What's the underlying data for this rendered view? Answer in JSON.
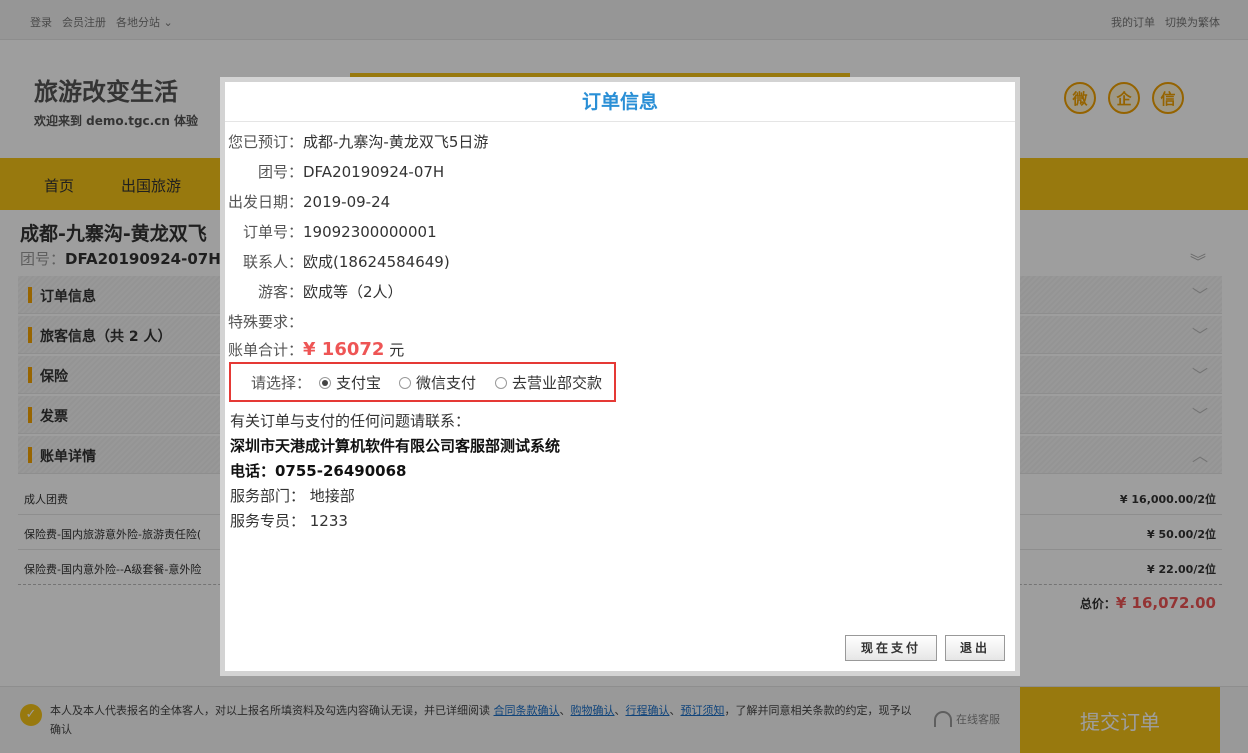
{
  "topbar": {
    "login": "登录",
    "register": "会员注册",
    "branches": "各地分站",
    "my_orders": "我的订单",
    "switch_traditional": "切换为繁体"
  },
  "header": {
    "brand_title": "旅游改变生活",
    "brand_subtitle": "欢迎来到 demo.tgc.cn 体验",
    "social": [
      "微",
      "企",
      "信"
    ]
  },
  "nav": {
    "items": [
      "首页",
      "出国旅游"
    ]
  },
  "product": {
    "title": "成都-九寨沟-黄龙双飞",
    "group_label": "团号：",
    "group_no": "DFA20190924-07H"
  },
  "sections": [
    {
      "label": "订单信息"
    },
    {
      "label": "旅客信息（共 2 人）"
    },
    {
      "label": "保险"
    },
    {
      "label": "发票"
    },
    {
      "label": "账单详情"
    }
  ],
  "fees": [
    {
      "name": "成人团费",
      "amount": "¥ 16,000.00/2位"
    },
    {
      "name": "保险费-国内旅游意外险-旅游责任险(",
      "amount": "¥ 50.00/2位"
    },
    {
      "name": "保险费-国内意外险--A级套餐-意外险",
      "amount": "¥ 22.00/2位"
    }
  ],
  "total": {
    "label": "总价：",
    "value": "¥ 16,072.00"
  },
  "footer": {
    "agree_prefix": "本人及本人代表报名的全体客人，对以上报名所填资料及勾选内容确认无误，并已详细阅读",
    "link_contract": "合同条款确认",
    "link_shopping": "购物确认",
    "link_itinerary": "行程确认",
    "link_notice": "预订须知",
    "agree_suffix": "，了解并同意相关条款的约定，现予以确认",
    "sep": "、",
    "online_service": "在线客服",
    "submit": "提交订单"
  },
  "modal": {
    "title": "订单信息",
    "rows": [
      {
        "label": "您已预订：",
        "value": "成都-九寨沟-黄龙双飞5日游"
      },
      {
        "label": "团号：",
        "value": "DFA20190924-07H"
      },
      {
        "label": "出发日期：",
        "value": "2019-09-24"
      },
      {
        "label": "订单号：",
        "value": "19092300000001"
      },
      {
        "label": "联系人：",
        "value": "欧成(18624584649)"
      },
      {
        "label": "游客：",
        "value": "欧成等（2人）"
      },
      {
        "label": "特殊要求：",
        "value": ""
      }
    ],
    "bill": {
      "label": "账单合计：",
      "amount": "¥ 16072",
      "unit": "元"
    },
    "payment": {
      "label": "请选择：",
      "options": [
        "支付宝",
        "微信支付",
        "去营业部交款"
      ],
      "selected": "支付宝"
    },
    "contact_intro": "有关订单与支付的任何问题请联系：",
    "company": "深圳市天港成计算机软件有限公司客服部测试系统",
    "phone": "电话：0755-26490068",
    "department": "服务部门： 地接部",
    "specialist": "服务专员： 1233",
    "pay_now": "现在支付",
    "exit": "退出"
  }
}
